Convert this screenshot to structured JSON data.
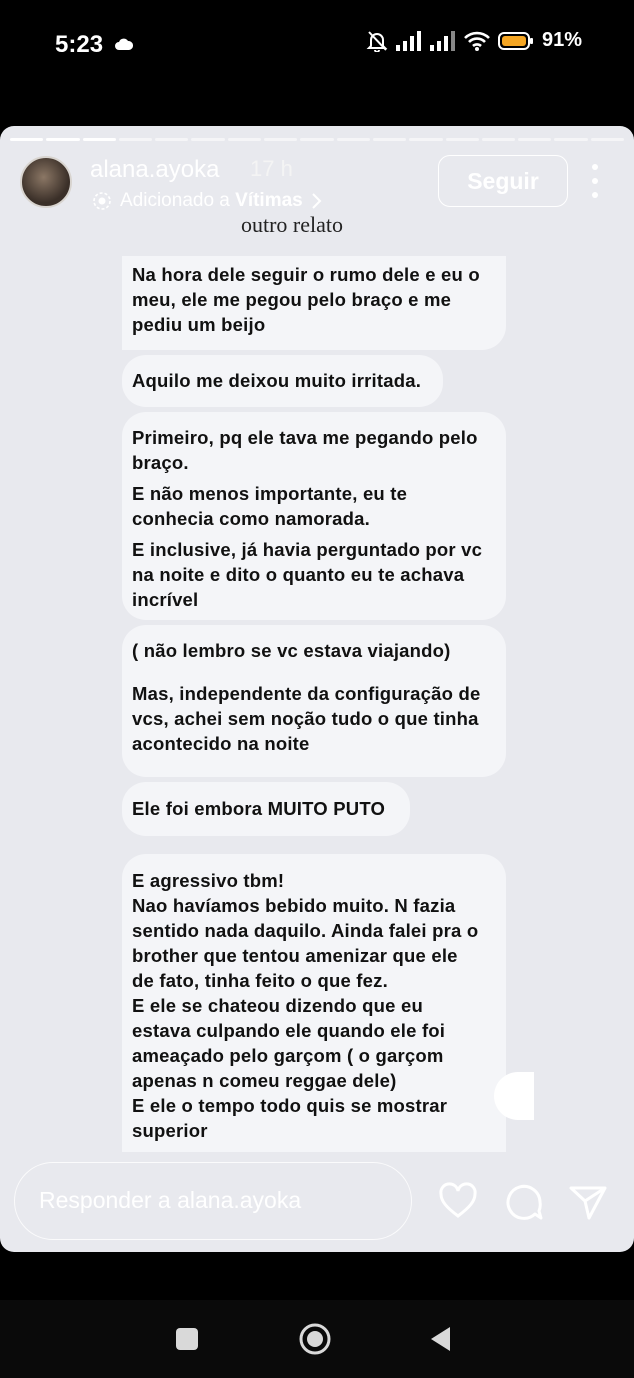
{
  "status_bar": {
    "time": "5:23",
    "battery": "91%"
  },
  "story": {
    "username": "alana.ayoka",
    "time_ago": "17 h",
    "added_prefix": "Adicionado a ",
    "added_collection": "Vítimas",
    "follow_label": "Seguir",
    "caption": "outro relato",
    "progress_total": 17,
    "progress_done": 3
  },
  "chat": {
    "bubbles": [
      {
        "lines": [
          "Na hora dele seguir o rumo dele e eu o\nmeu, ele me pegou pelo braço e me\npediu um beijo"
        ]
      },
      {
        "lines": [
          "Aquilo me deixou muito irritada."
        ]
      },
      {
        "lines": [
          "Primeiro, pq ele tava me pegando pelo\nbraço.",
          "E não menos importante, eu te\nconhecia como namorada.",
          "E inclusive, já havia perguntado por vc\nna noite e dito o quanto eu te achava\nincrível"
        ]
      },
      {
        "lines": [
          "( não lembro se vc estava viajando)",
          "",
          "Mas, independente da configuração de\nvcs, achei sem noção tudo o que tinha\nacontecido na noite"
        ]
      },
      {
        "lines": [
          "Ele foi embora MUITO PUTO"
        ]
      },
      {
        "lines": [
          "E agressivo tbm!\nNao havíamos bebido muito. N fazia\nsentido nada daquilo. Ainda falei pra o\nbrother que tentou amenizar que ele\nde fato, tinha feito o que fez.\nE ele se chateou dizendo que eu\nestava culpando ele quando ele foi\nameaçado pelo garçom ( o garçom\napenas n comeu reggae dele)\nE ele o tempo todo quis se mostrar\nsuperior"
        ]
      }
    ]
  },
  "reply": {
    "placeholder": "Responder a alana.ayoka"
  },
  "icons": {
    "like": "heart-icon",
    "comment": "comment-icon",
    "share": "send-icon",
    "nav_recents": "square-icon",
    "nav_home": "circle-icon",
    "nav_back": "triangle-back-icon"
  }
}
